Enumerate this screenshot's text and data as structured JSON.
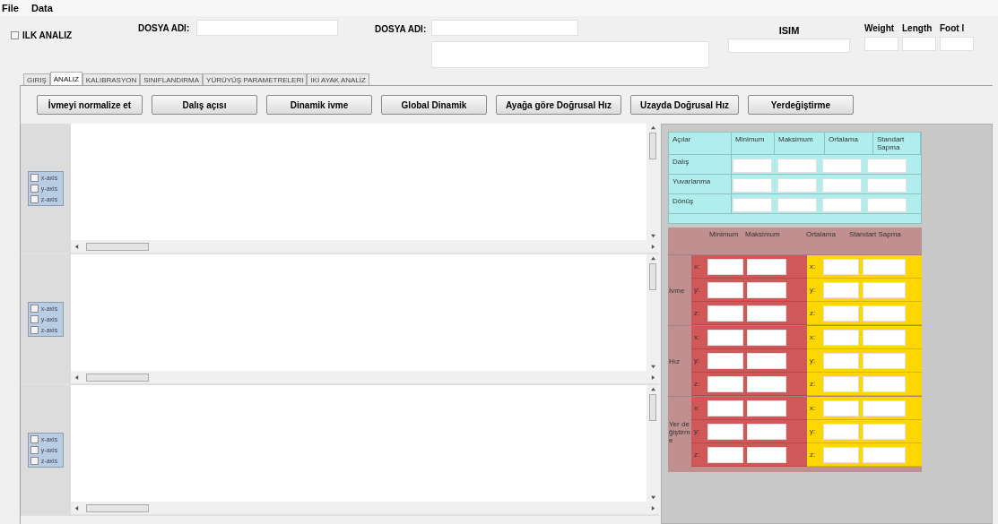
{
  "menu": [
    "File",
    "Data"
  ],
  "header": {
    "ilk_analiz": {
      "label": "ILK ANALIZ",
      "checked": false
    },
    "file_name_1": {
      "label": "DOSYA ADI:"
    },
    "file_name_2": {
      "label": "DOSYA ADI:"
    },
    "name": {
      "label": "ISIM"
    },
    "measures": [
      "Weight",
      "Length",
      "Foot l"
    ]
  },
  "tabs": [
    {
      "label": "GIRIŞ",
      "selected": false
    },
    {
      "label": "ANALIZ",
      "selected": true
    },
    {
      "label": "KALIBRASYON",
      "selected": false
    },
    {
      "label": "SINIFLANDIRMA",
      "selected": false
    },
    {
      "label": "YÜRÜYÜŞ PARAMETRELERI",
      "selected": false
    },
    {
      "label": "İKİ AYAK ANALİZ",
      "selected": false
    }
  ],
  "buttons": [
    "İvmeyi normalize et",
    "Dalış açısı",
    "Dinamik ivme",
    "Global Dinamik",
    "Ayağa göre Doğrusal Hız",
    "Uzayda Doğrusal Hız",
    "Yerdeğiştirme"
  ],
  "charts": [
    {
      "axes": [
        {
          "label": "x-axis",
          "checked": false
        },
        {
          "label": "y-axis",
          "checked": false
        },
        {
          "label": "z-axis",
          "checked": false
        }
      ]
    },
    {
      "axes": [
        {
          "label": "x-axis",
          "checked": false
        },
        {
          "label": "y-axis",
          "checked": false
        },
        {
          "label": "z-axis",
          "checked": false
        }
      ]
    },
    {
      "axes": [
        {
          "label": "x-axis",
          "checked": false
        },
        {
          "label": "y-axis",
          "checked": false
        },
        {
          "label": "z-axis",
          "checked": false
        }
      ]
    }
  ],
  "angle_table": {
    "columns": [
      "Açılar",
      "Minimum",
      "Maksimum",
      "Ortalama",
      "Standart Sapma"
    ],
    "rows": [
      "Dalış",
      "Yuvarlanma",
      "Dönüş"
    ]
  },
  "motion_table": {
    "columns": [
      "Minimum",
      "Maksimum",
      "Ortalama",
      "Standart Sapma"
    ],
    "groups": [
      {
        "label": "İvme",
        "axes": [
          {
            "left": "x:",
            "right": "x:"
          },
          {
            "left": "y:",
            "right": "y:"
          },
          {
            "left": "z:",
            "right": "z:"
          }
        ]
      },
      {
        "label": "Hız",
        "axes": [
          {
            "left": "x:",
            "right": "x:"
          },
          {
            "left": "y:",
            "right": "y:"
          },
          {
            "left": "z:",
            "right": "z:"
          }
        ]
      },
      {
        "label": "Yer değiştirme",
        "axes": [
          {
            "left": "x:",
            "right": "x:"
          },
          {
            "left": "y:",
            "right": "y:"
          },
          {
            "left": "z:",
            "right": "z:"
          }
        ]
      }
    ]
  }
}
